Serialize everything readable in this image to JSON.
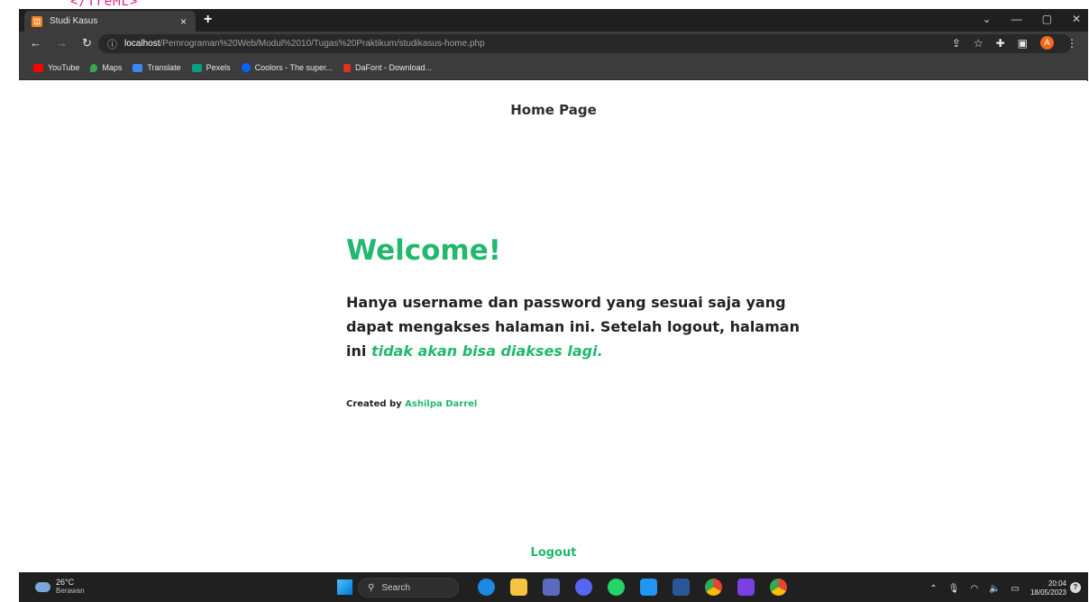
{
  "browser": {
    "tab_title": "Studi Kasus",
    "tab_close": "×",
    "new_tab": "+",
    "window_controls": [
      "⌄",
      "—",
      "▢",
      "✕"
    ],
    "url_host": "localhost",
    "url_path": "/Pemrograman%20Web/Modul%2010/Tugas%20Praktikum/studikasus-home.php",
    "profile_initial": "A",
    "bookmarks": [
      {
        "label": "YouTube",
        "color": "#ff0000"
      },
      {
        "label": "Maps",
        "color": "#34a853"
      },
      {
        "label": "Translate",
        "color": "#4285f4"
      },
      {
        "label": "Pexels",
        "color": "#05a081"
      },
      {
        "label": "Coolors - The super...",
        "color": "#0066ff"
      },
      {
        "label": "DaFont - Download...",
        "color": "#e0321c"
      }
    ]
  },
  "page": {
    "title": "Home Page",
    "welcome": "Welcome!",
    "desc_main": "Hanya username dan password yang sesuai saja yang dapat mengakses halaman ini. Setelah logout, halaman ini ",
    "desc_emphasis": "tidak akan bisa diakses lagi.",
    "credit_prefix": "Created by ",
    "credit_name": "Ashilpa Darrel",
    "logout": "Logout"
  },
  "taskbar": {
    "temperature": "26°C",
    "weather": "Berawan",
    "search_label": "Search",
    "time": "20:04",
    "date": "18/05/2023"
  },
  "colors": {
    "accent_green": "#22b86e",
    "chrome_dark": "#3c3c3c",
    "taskbar": "#202020"
  }
}
